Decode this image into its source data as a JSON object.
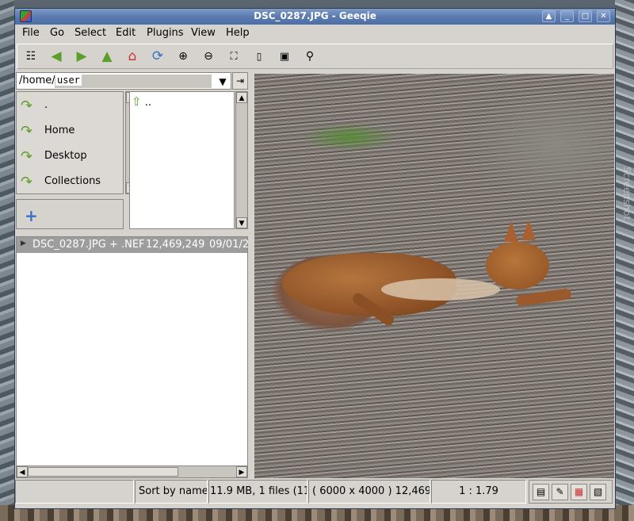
{
  "window": {
    "title": "DSC_0287.JPG - Geeqie"
  },
  "menu": {
    "items": [
      "File",
      "Go",
      "Select",
      "Edit",
      "Plugins",
      "View",
      "Help"
    ]
  },
  "toolbar": {
    "buttons": [
      "thumbnails",
      "back",
      "forward",
      "up",
      "home",
      "refresh",
      "zoom-in",
      "zoom-out",
      "zoom-fit",
      "zoom-1-1",
      "floating",
      "pin"
    ]
  },
  "path": {
    "prefix": "/home/",
    "selected": "user"
  },
  "bookmarks": {
    "items": [
      {
        "label": "."
      },
      {
        "label": "Home"
      },
      {
        "label": "Desktop"
      },
      {
        "label": "Collections"
      }
    ]
  },
  "folders": {
    "parent": ".."
  },
  "files": {
    "rows": [
      {
        "name": "DSC_0287.JPG + .NEF",
        "size": "12,469,249",
        "date": "09/01/2"
      }
    ]
  },
  "status": {
    "sort": "Sort by name",
    "summary": "11.9 MB, 1 files (11",
    "image_info": "( 6000 x 4000 ) 12,469,2",
    "zoom": "1 : 1.79"
  },
  "desktop": {
    "watermark": "Screenshot"
  }
}
